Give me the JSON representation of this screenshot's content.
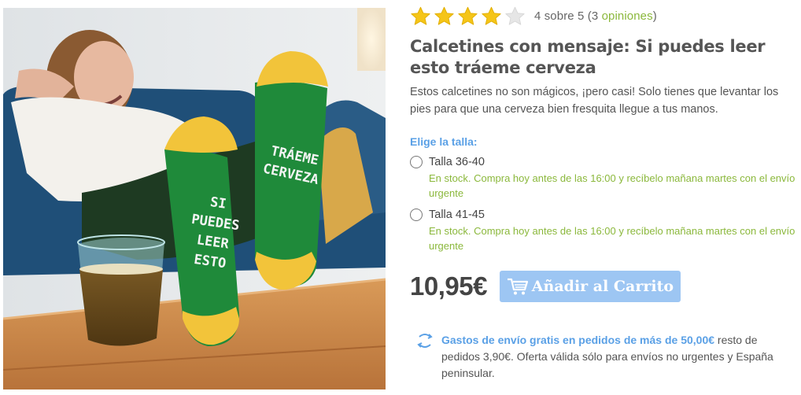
{
  "rating": {
    "value": 4,
    "max": 5,
    "text": "4 sobre 5",
    "open_paren": " (",
    "count_number": "3",
    "count_word": "opiniones",
    "close_paren": ")",
    "star_color": "#f5c518",
    "star_empty_color": "#e6e6e6"
  },
  "product": {
    "title": "Calcetines con mensaje: Si puedes leer esto tráeme cerveza",
    "description": "Estos calcetines no son mágicos, ¡pero casi! Solo tienes que levantar los pies para que una cerveza bien fresquita llegue a tus manos.",
    "image_icon": "product-photo",
    "sock_left_text": [
      "SI",
      "PUEDES",
      "LEER",
      "ESTO"
    ],
    "sock_right_text": [
      "TRÁEME",
      "CERVEZA"
    ]
  },
  "size": {
    "label": "Elige la talla:",
    "options": [
      {
        "label": "Talla 36-40",
        "stock": "En stock. Compra hoy antes de las 16:00 y recíbelo mañana martes con el envío urgente"
      },
      {
        "label": "Talla 41-45",
        "stock": "En stock. Compra hoy antes de las 16:00 y recíbelo mañana martes con el envío urgente"
      }
    ]
  },
  "purchase": {
    "price": "10,95€",
    "add_to_cart": "Añadir al Carrito",
    "cart_icon": "cart-icon",
    "button_color": "#9dc6f3"
  },
  "shipping": {
    "icon": "truck-icon",
    "highlight": "Gastos de envío gratis en pedidos de más de 50,00€",
    "rest": " resto de pedidos 3,90€. Oferta válida sólo para envíos no urgentes y España peninsular."
  },
  "colors": {
    "accent_blue": "#5aa0e6",
    "stock_green": "#8bb83c",
    "text": "#555555"
  }
}
